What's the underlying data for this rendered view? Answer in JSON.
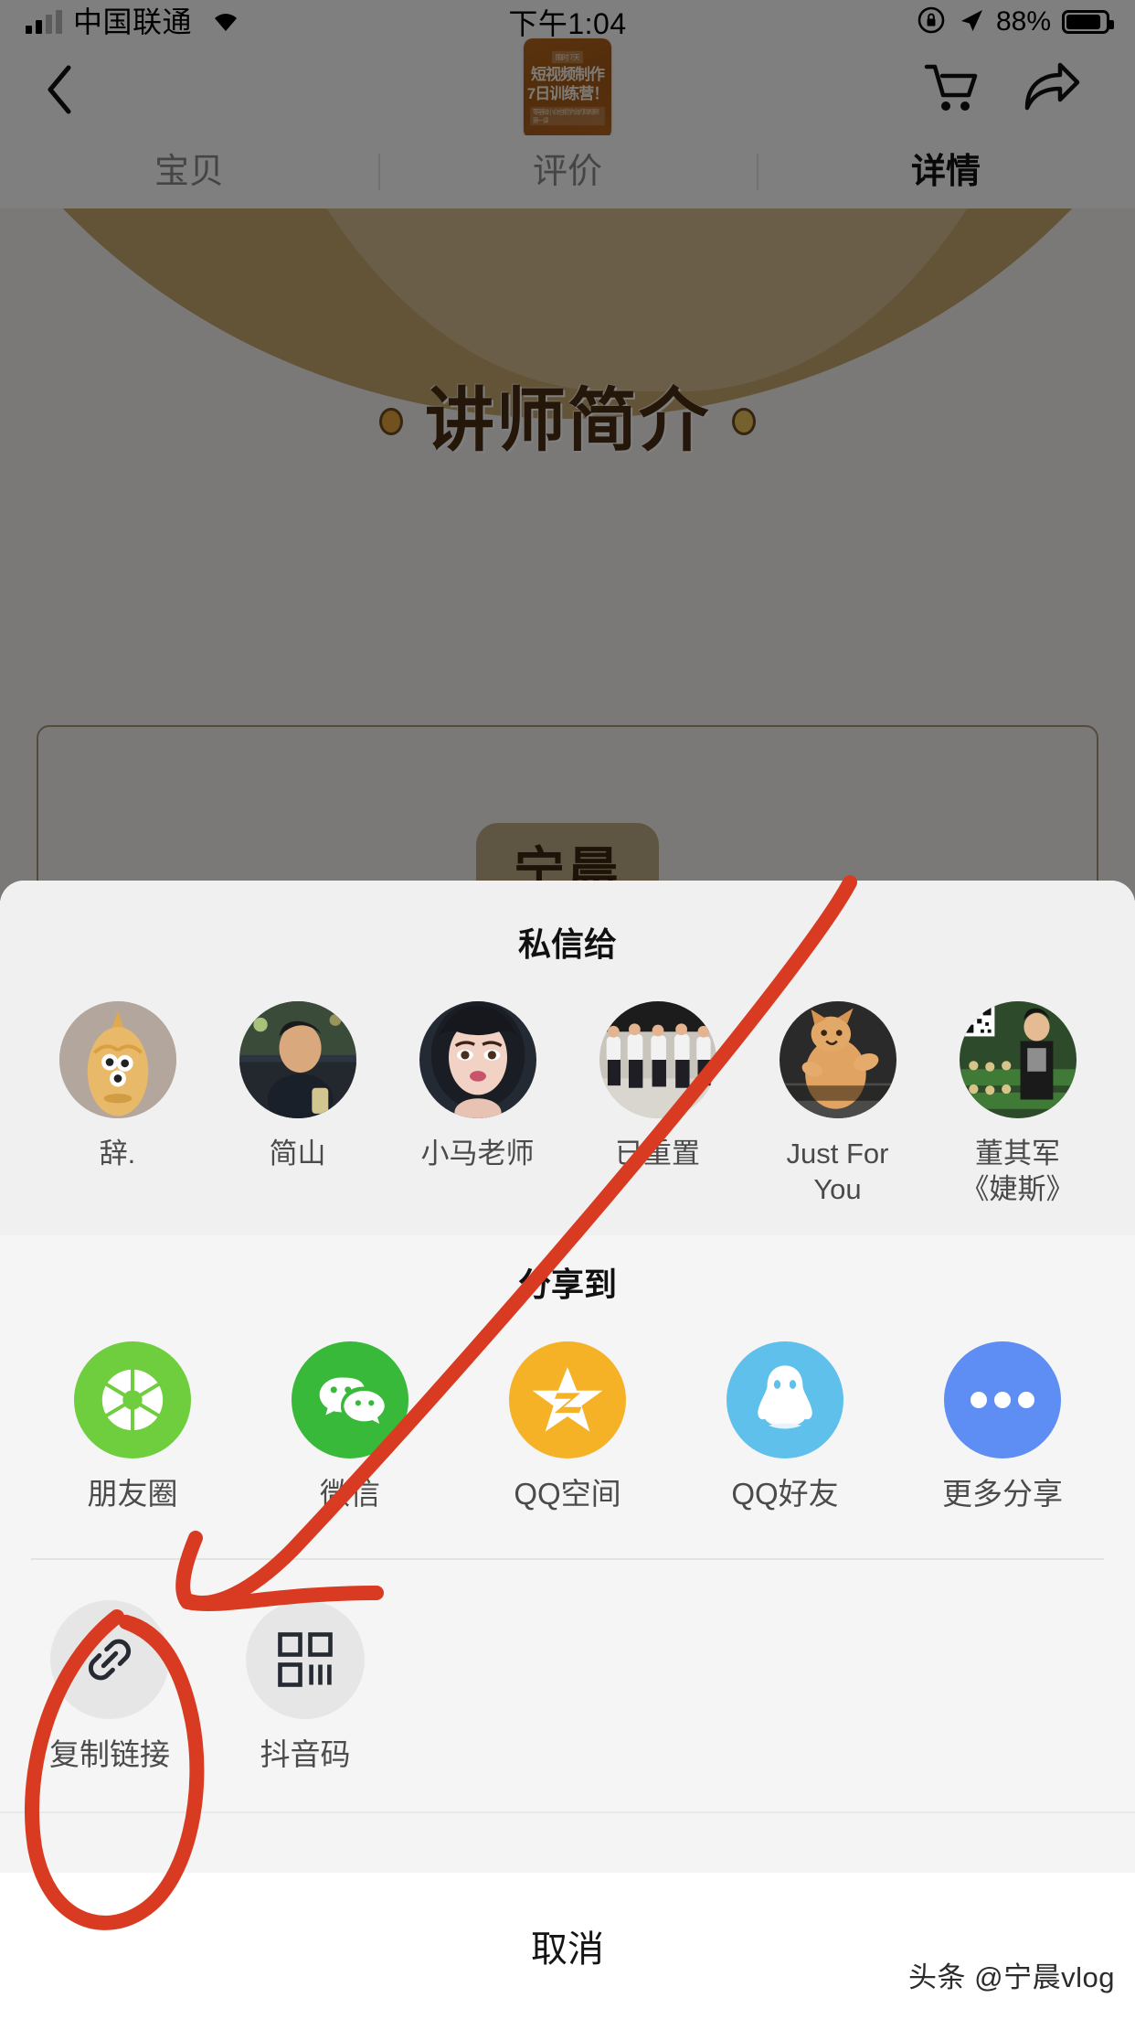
{
  "status_bar": {
    "carrier": "中国联通",
    "time": "下午1:04",
    "battery_percent": "88%",
    "wifi_icon": "wifi-icon",
    "signal_icon": "signal-bars-icon",
    "rotation_lock_icon": "rotation-lock-icon",
    "location_icon": "location-arrow-icon",
    "battery_icon": "battery-icon"
  },
  "navbar": {
    "back_icon": "chevron-left-icon",
    "cart_icon": "shopping-cart-icon",
    "share_icon": "share-arrow-icon",
    "thumbnail": {
      "badge": "限时 7天",
      "line1": "短视频制作",
      "line2": "7日训练营！",
      "line3": "零基础小白也能学会的短视频第一课"
    }
  },
  "tabs": [
    {
      "label": "宝贝",
      "active": false
    },
    {
      "label": "评价",
      "active": false
    },
    {
      "label": "详情",
      "active": true
    }
  ],
  "detail": {
    "section_title": "讲师简介",
    "instructor_name": "宁晨"
  },
  "sheet": {
    "friends_title": "私信给",
    "friends": [
      {
        "name": "辞.",
        "avatar": "cartoon-chick-avatar"
      },
      {
        "name": "简山",
        "avatar": "man-night-street-avatar"
      },
      {
        "name": "小马老师",
        "avatar": "woman-selfie-avatar"
      },
      {
        "name": "已重置",
        "avatar": "group-photo-avatar"
      },
      {
        "name": "Just For You",
        "avatar": "orange-cat-avatar"
      },
      {
        "name": "董其军《婕斯》",
        "avatar": "man-store-qrcode-avatar"
      }
    ],
    "share_title": "分享到",
    "share_apps": [
      {
        "label": "朋友圈",
        "icon": "moments-aperture-icon",
        "color": "#6fce3e"
      },
      {
        "label": "微信",
        "icon": "wechat-icon",
        "color": "#38b93a"
      },
      {
        "label": "QQ空间",
        "icon": "qzone-star-icon",
        "color": "#f5b227"
      },
      {
        "label": "QQ好友",
        "icon": "qq-penguin-icon",
        "color": "#5ec0eb"
      },
      {
        "label": "更多分享",
        "icon": "more-dots-icon",
        "color": "#5e8df3"
      }
    ],
    "tools": [
      {
        "label": "复制链接",
        "icon": "link-chain-icon"
      },
      {
        "label": "抖音码",
        "icon": "qr-code-icon"
      }
    ],
    "cancel_label": "取消"
  },
  "watermark": "头条 @宁晨vlog",
  "annotation": {
    "color": "#d83b21"
  }
}
